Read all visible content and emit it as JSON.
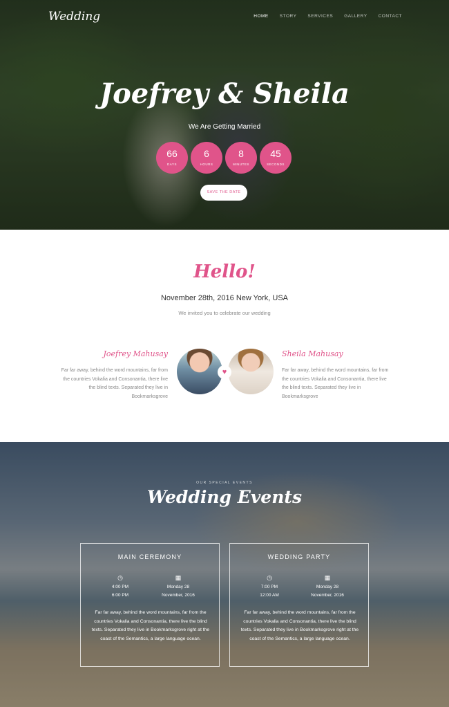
{
  "brand": {
    "logo": "Wedding"
  },
  "nav": {
    "items": [
      "HOME",
      "STORY",
      "SERVICES",
      "GALLERY",
      "CONTACT"
    ]
  },
  "hero": {
    "title": "Joefrey & Sheila",
    "subtitle": "We Are Getting Married",
    "countdown": [
      {
        "value": "66",
        "label": "DAYS"
      },
      {
        "value": "6",
        "label": "HOURS"
      },
      {
        "value": "8",
        "label": "MINUTES"
      },
      {
        "value": "45",
        "label": "SECONDS"
      }
    ],
    "button": "SAVE THE DATE"
  },
  "intro": {
    "heading": "Hello!",
    "date_location": "November 28th, 2016 New York, USA",
    "invite": "We invited you to celebrate our wedding",
    "heart_icon": "heart-icon",
    "groom": {
      "name": "Joefrey Mahusay",
      "text": "Far far away, behind the word mountains, far from the countries Vokalia and Consonantia, there live the blind texts. Separated they live in Bookmarksgrove"
    },
    "bride": {
      "name": "Sheila Mahusay",
      "text": "Far far away, behind the word mountains, far from the countries Vokalia and Consonantia, there live the blind texts. Separated they live in Bookmarksgrove"
    }
  },
  "events": {
    "eyebrow": "OUR SPECIAL EVENTS",
    "title": "Wedding Events",
    "cards": [
      {
        "title": "MAIN CEREMONY",
        "time_icon": "clock-icon",
        "time_start": "4:00 PM",
        "time_end": "6:00 PM",
        "date_icon": "calendar-icon",
        "date_day": "Monday 28",
        "date_month": "November, 2016",
        "text": "Far far away, behind the word mountains, far from the countries Vokalia and Consonantia, there live the blind texts. Separated they live in Bookmarksgrove right at the coast of the Semantics, a large language ocean."
      },
      {
        "title": "WEDDING PARTY",
        "time_icon": "clock-icon",
        "time_start": "7:00 PM",
        "time_end": "12:00 AM",
        "date_icon": "calendar-icon",
        "date_day": "Monday 28",
        "date_month": "November, 2016",
        "text": "Far far away, behind the word mountains, far from the countries Vokalia and Consonantia, there live the blind texts. Separated they live in Bookmarksgrove right at the coast of the Semantics, a large language ocean."
      }
    ]
  },
  "colors": {
    "accent": "#e0548a"
  }
}
